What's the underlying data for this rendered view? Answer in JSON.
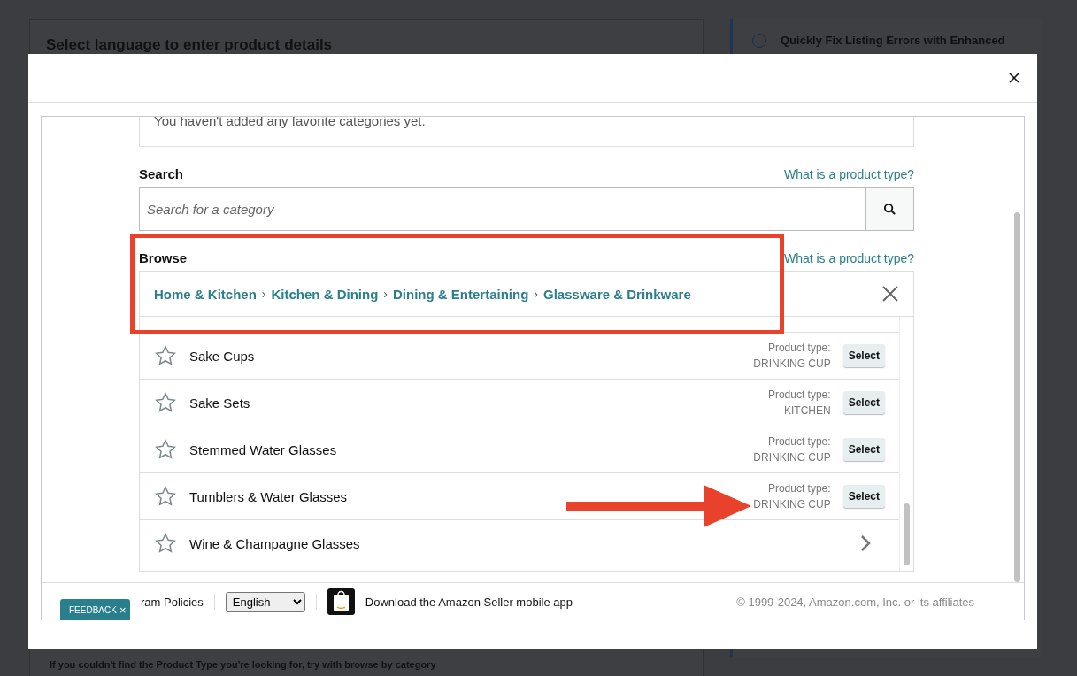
{
  "background": {
    "left_card_title": "Select language to enter product details",
    "right_card_title": "Quickly Fix Listing Errors with Enhanced",
    "bottom_hint": "If you couldn't find the Product Type you're looking for, try with browse by category"
  },
  "modal": {
    "favorites_empty": "You haven't added any favorite categories yet.",
    "search": {
      "label": "Search",
      "help_link": "What is a product type?",
      "placeholder": "Search for a category"
    },
    "browse": {
      "label": "Browse",
      "help_link": "What is a product type?",
      "breadcrumbs": [
        "Home & Kitchen",
        "Kitchen & Dining",
        "Dining & Entertaining",
        "Glassware & Drinkware"
      ],
      "separator": "›"
    },
    "categories": [
      {
        "kind": "leaf",
        "name": "Sake Cups",
        "type_label": "Product type:",
        "type_value": "DRINKING CUP",
        "button": "Select",
        "favorite": false
      },
      {
        "kind": "leaf",
        "name": "Sake Sets",
        "type_label": "Product type:",
        "type_value": "KITCHEN",
        "button": "Select",
        "favorite": false
      },
      {
        "kind": "leaf",
        "name": "Stemmed Water Glasses",
        "type_label": "Product type:",
        "type_value": "DRINKING CUP",
        "button": "Select",
        "favorite": false
      },
      {
        "kind": "leaf",
        "name": "Tumblers & Water Glasses",
        "type_label": "Product type:",
        "type_value": "DRINKING CUP",
        "button": "Select",
        "favorite": false
      },
      {
        "kind": "branch",
        "name": "Wine & Champagne Glasses",
        "favorite": false
      }
    ],
    "footer": {
      "policies": "ram Policies",
      "language": "English",
      "app_link": "Download the Amazon Seller mobile app",
      "copyright": "© 1999-2024, Amazon.com, Inc. or its affiliates"
    },
    "feedback_tab": {
      "label": "FEEDBACK",
      "close": "×"
    }
  }
}
